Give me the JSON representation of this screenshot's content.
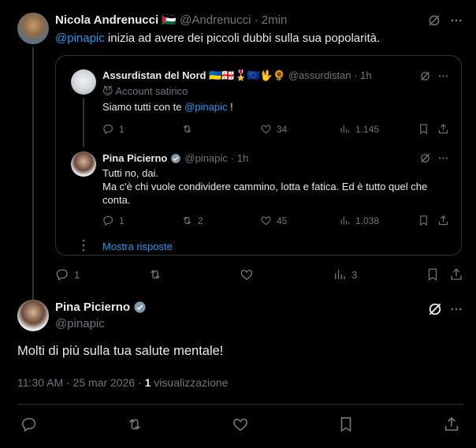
{
  "tweet1": {
    "name": "Nicola Andrenucci",
    "flag": "🇵🇸",
    "handle": "@Andrenucci",
    "time": "· 2min",
    "mention": "@pinapic",
    "text": " inizia ad avere dei piccoli dubbi sulla sua popolarità.",
    "replies": "1",
    "views": "3"
  },
  "quote": {
    "tweetA": {
      "name": "Assurdistan del Nord",
      "emojis": "🇺🇦🇬🇪🎖️🇪🇺🖖🌻",
      "handle": "@assurdistan",
      "time": "· 1h",
      "label_icon": "😈",
      "label": "Account satirico",
      "text_pre": "Siamo tutti con te ",
      "mention": "@pinapic",
      "text_post": " !",
      "replies": "1",
      "retweets": "",
      "likes": "34",
      "views": "1.145"
    },
    "tweetB": {
      "name": "Pina Picierno",
      "handle": "@pinapic",
      "time": "· 1h",
      "line1": "Tutti no, dai.",
      "line2": "Ma c'è chi vuole condividere cammino, lotta e fatica. Ed è tutto quel che",
      "line3": "conta.",
      "replies": "1",
      "retweets": "2",
      "likes": "45",
      "views": "1.038"
    },
    "show_replies": "Mostra risposte"
  },
  "main": {
    "name": "Pina Picierno",
    "handle": "@pinapic",
    "text": "Molti di più sulla tua salute mentale!",
    "time": "11:30 AM · 25 mar 2026 · ",
    "views_count": "1",
    "views_label": " visualizzazione"
  },
  "colors": {
    "accent": "#1d9bf0",
    "muted": "#71767b",
    "background": "#000000"
  }
}
